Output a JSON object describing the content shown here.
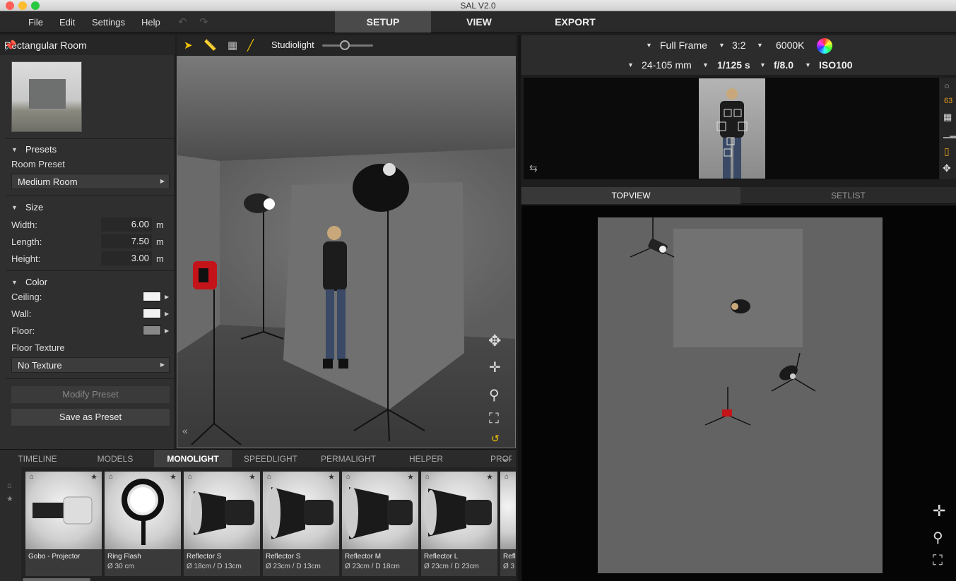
{
  "window": {
    "title": "SAL V2.0"
  },
  "menu": {
    "items": [
      "File",
      "Edit",
      "Settings",
      "Help"
    ]
  },
  "main_tabs": [
    "SETUP",
    "VIEW",
    "EXPORT"
  ],
  "left_panel": {
    "title": "Rectangular Room",
    "presets": {
      "header": "Presets",
      "label": "Room Preset",
      "value": "Medium Room"
    },
    "size": {
      "header": "Size",
      "width": {
        "label": "Width:",
        "value": "6.00",
        "unit": "m"
      },
      "length": {
        "label": "Length:",
        "value": "7.50",
        "unit": "m"
      },
      "height": {
        "label": "Height:",
        "value": "3.00",
        "unit": "m"
      }
    },
    "color": {
      "header": "Color",
      "ceiling": {
        "label": "Ceiling:",
        "color": "#f2f2f2"
      },
      "wall": {
        "label": "Wall:",
        "color": "#f2f2f2"
      },
      "floor": {
        "label": "Floor:",
        "color": "#888888"
      },
      "texture_label": "Floor Texture",
      "texture_value": "No Texture"
    },
    "modify_button": "Modify Preset",
    "save_button": "Save as Preset"
  },
  "viewport_toolbar": {
    "light_label": "Studiolight",
    "light_level": 0.45
  },
  "camera": {
    "format": "Full Frame",
    "ratio": "3:2",
    "white_balance": "6000K",
    "lens": "24-105 mm",
    "shutter": "1/125 s",
    "aperture": "f/8.0",
    "iso": "ISO100"
  },
  "side_readout": "63",
  "right_tabs": [
    "TOPVIEW",
    "SETLIST"
  ],
  "bottom_tabs": [
    "TIMELINE",
    "MODELS",
    "MONOLIGHT",
    "SPEEDLIGHT",
    "PERMALIGHT",
    "HELPER",
    "PROPS"
  ],
  "library": [
    {
      "name": "Gobo - Projector",
      "sub": ""
    },
    {
      "name": "Ring Flash",
      "sub": "Ø 30 cm"
    },
    {
      "name": "Reflector S",
      "sub": "Ø 18cm / D 13cm"
    },
    {
      "name": "Reflector S",
      "sub": "Ø 23cm / D 13cm"
    },
    {
      "name": "Reflector M",
      "sub": "Ø 23cm / D 18cm"
    },
    {
      "name": "Reflector L",
      "sub": "Ø 23cm / D 23cm"
    },
    {
      "name": "Refl",
      "sub": "Ø 3"
    }
  ]
}
